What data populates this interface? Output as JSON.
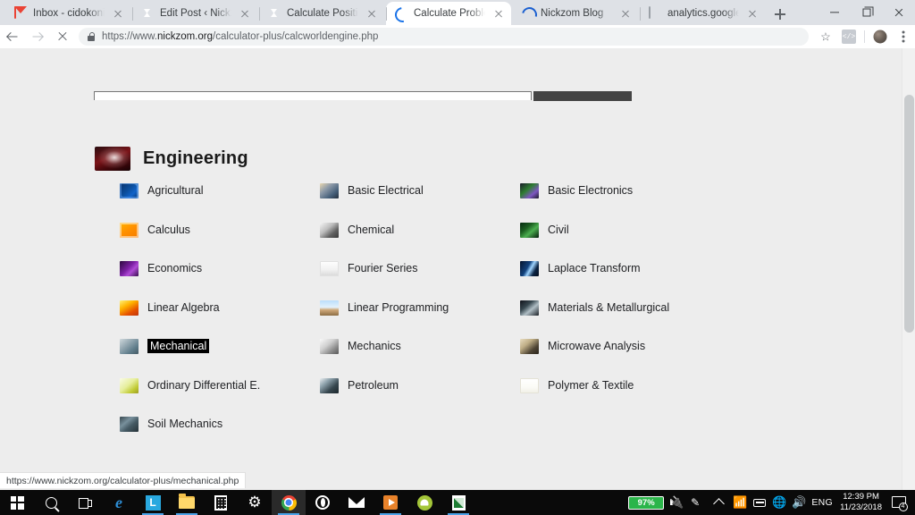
{
  "browser": {
    "tabs": [
      {
        "title": "Inbox - cidokonicholas@",
        "favicon": "gmail-icon",
        "active": false
      },
      {
        "title": "Edit Post ‹ Nickzom Blog",
        "favicon": "wordpress-icon",
        "active": false
      },
      {
        "title": "Calculate Position of Tu",
        "favicon": "wordpress-icon",
        "active": false
      },
      {
        "title": "Calculate Problems | Eng",
        "favicon": "loading-spinner-icon",
        "active": true
      },
      {
        "title": "Nickzom Blog",
        "favicon": "loading-spinner-icon",
        "active": false
      },
      {
        "title": "analytics.google.com",
        "favicon": "page-icon",
        "active": false
      }
    ],
    "new_tab_label": "+",
    "window_controls": {
      "minimize": "–",
      "maximize": "❐",
      "close": "✕"
    },
    "toolbar": {
      "back_label": "Back",
      "forward_label": "Forward",
      "stop_label": "Stop",
      "url_scheme": "https://www.",
      "url_domain": "nickzom.org",
      "url_path": "/calculator-plus/calcworldengine.php",
      "bookmark_label": "☆",
      "extension_label": "</>",
      "profile_label": "Profile",
      "menu_label": "Customize and control Google Chrome"
    }
  },
  "page": {
    "heading": "Engineering",
    "heading_icon": "engineering-thumb-icon",
    "columns": [
      [
        {
          "label": "Agricultural",
          "icon": "agricultural-icon",
          "icon_class": "ic-agri",
          "selected": false
        },
        {
          "label": "Calculus",
          "icon": "calculus-icon",
          "icon_class": "ic-calc",
          "selected": false
        },
        {
          "label": "Economics",
          "icon": "economics-icon",
          "icon_class": "ic-econ",
          "selected": false
        },
        {
          "label": "Linear Algebra",
          "icon": "linear-algebra-icon",
          "icon_class": "ic-lina",
          "selected": false
        },
        {
          "label": "Mechanical",
          "icon": "mechanical-icon",
          "icon_class": "ic-mech",
          "selected": true
        },
        {
          "label": "Ordinary Differential E.",
          "icon": "ordinary-differential-icon",
          "icon_class": "ic-ode",
          "selected": false
        },
        {
          "label": "Soil Mechanics",
          "icon": "soil-mechanics-icon",
          "icon_class": "ic-soil",
          "selected": false
        }
      ],
      [
        {
          "label": "Basic Electrical",
          "icon": "basic-electrical-icon",
          "icon_class": "ic-belec",
          "selected": false
        },
        {
          "label": "Chemical",
          "icon": "chemical-icon",
          "icon_class": "ic-chem",
          "selected": false
        },
        {
          "label": "Fourier Series",
          "icon": "fourier-series-icon",
          "icon_class": "ic-four",
          "selected": false
        },
        {
          "label": "Linear Programming",
          "icon": "linear-programming-icon",
          "icon_class": "ic-linp",
          "selected": false
        },
        {
          "label": "Mechanics",
          "icon": "mechanics-icon",
          "icon_class": "ic-mecs",
          "selected": false
        },
        {
          "label": "Petroleum",
          "icon": "petroleum-icon",
          "icon_class": "ic-petro",
          "selected": false
        }
      ],
      [
        {
          "label": "Basic Electronics",
          "icon": "basic-electronics-icon",
          "icon_class": "ic-belex",
          "selected": false
        },
        {
          "label": "Civil",
          "icon": "civil-icon",
          "icon_class": "ic-civil",
          "selected": false
        },
        {
          "label": "Laplace Transform",
          "icon": "laplace-transform-icon",
          "icon_class": "ic-lap",
          "selected": false
        },
        {
          "label": "Materials & Metallurgical",
          "icon": "materials-metallurgical-icon",
          "icon_class": "ic-mat",
          "selected": false
        },
        {
          "label": "Microwave Analysis",
          "icon": "microwave-analysis-icon",
          "icon_class": "ic-micro",
          "selected": false
        },
        {
          "label": "Polymer & Textile",
          "icon": "polymer-textile-icon",
          "icon_class": "ic-poly",
          "selected": false
        }
      ]
    ]
  },
  "status_bar": {
    "url": "https://www.nickzom.org/calculator-plus/mechanical.php"
  },
  "taskbar": {
    "items": [
      {
        "name": "start-button",
        "icon": "windows-start-icon"
      },
      {
        "name": "search-button",
        "icon": "search-icon"
      },
      {
        "name": "task-view-button",
        "icon": "task-view-icon"
      },
      {
        "name": "edge-button",
        "icon": "edge-icon"
      },
      {
        "name": "app-l-button",
        "icon": "letter-l-icon"
      },
      {
        "name": "file-explorer-button",
        "icon": "folder-icon"
      },
      {
        "name": "calculator-button",
        "icon": "calculator-icon"
      },
      {
        "name": "settings-button",
        "icon": "gear-icon"
      },
      {
        "name": "chrome-button",
        "icon": "chrome-icon"
      },
      {
        "name": "opera-button",
        "icon": "opera-icon"
      },
      {
        "name": "mail-button",
        "icon": "mail-icon"
      },
      {
        "name": "media-player-button",
        "icon": "play-icon"
      },
      {
        "name": "android-studio-button",
        "icon": "android-icon"
      },
      {
        "name": "spreadsheet-button",
        "icon": "spreadsheet-icon"
      }
    ],
    "tray": {
      "battery_percent": "97%",
      "plug_icon": "power-plug-icon",
      "pen_icon": "pen-icon",
      "overflow_icon": "chevron-up-icon",
      "wifi_icon": "wifi-icon",
      "keyboard_icon": "keyboard-icon",
      "network_icon": "network-icon",
      "volume_icon": "volume-icon",
      "language": "ENG",
      "time": "12:39 PM",
      "date": "11/23/2018",
      "notification_icon": "notification-icon",
      "notification_count": "4"
    }
  },
  "colors": {
    "chrome_frame": "#dee1e6",
    "page_bg": "#ededed",
    "selection_bg": "#000000",
    "accent_blue": "#1a73e8",
    "battery_green": "#2bb54a"
  }
}
